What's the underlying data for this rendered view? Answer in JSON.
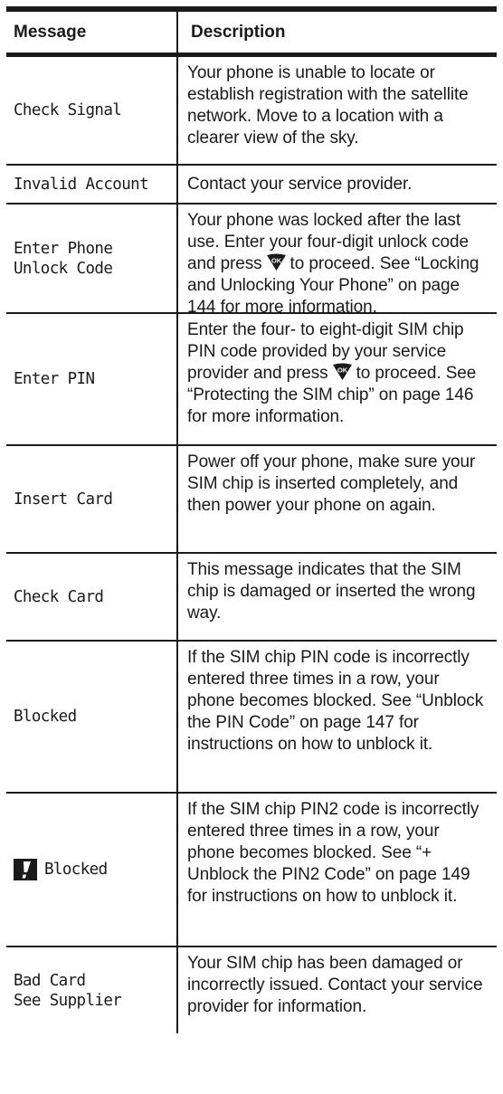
{
  "table": {
    "headers": {
      "message": "Message",
      "description": "Description"
    },
    "rows": [
      {
        "message": [
          "Check Signal"
        ],
        "description": [
          "Your phone is unable to locate or establish registration with the satellite network. Move to a location with a clearer view of the sky."
        ]
      },
      {
        "message": [
          "Invalid Account"
        ],
        "description": [
          "Contact your service provider."
        ]
      },
      {
        "message": [
          "Enter Phone",
          "Unlock Code"
        ],
        "description": [
          "Your phone was locked after the last use. Enter your four-digit unlock code and press",
          "to proceed. See “Locking and Unlocking Your Phone” on page 144 for more information."
        ]
      },
      {
        "message": [
          "Enter PIN"
        ],
        "description": [
          "Enter the four- to eight-digit SIM chip PIN code provided by your service provider and press",
          "to proceed. See “Protecting the SIM chip” on page 146 for more information."
        ]
      },
      {
        "message": [
          "Insert Card"
        ],
        "description": [
          "Power off your phone, make sure your SIM chip is inserted completely, and then power your phone on again."
        ]
      },
      {
        "message": [
          "Check Card"
        ],
        "description": [
          "This message indicates that the SIM chip is damaged or inserted the wrong way."
        ]
      },
      {
        "message": [
          "Blocked"
        ],
        "description": [
          "If the SIM chip PIN code is incorrectly entered three times in a row, your phone becomes blocked. See “Unblock the PIN Code” on page 147 for instructions on how to unblock it."
        ]
      },
      {
        "message": [
          "Blocked"
        ],
        "description": [
          "If the SIM chip PIN2 code is incorrectly entered three times in a row, your phone becomes blocked. See “+ Unblock the PIN2 Code” on page 149 for instructions on how to unblock it."
        ]
      },
      {
        "message": [
          "Bad Card",
          "See Supplier"
        ],
        "description": [
          "Your SIM chip has been damaged or incorrectly issued. Contact your service provider for information."
        ]
      }
    ]
  },
  "icons": {
    "ok_key": "ok-key-icon",
    "warning": "exclamation-icon"
  },
  "colors": {
    "rule": "#1a1a1a",
    "text": "#1a1a1a",
    "icon_fill": "#1a1a1a"
  }
}
